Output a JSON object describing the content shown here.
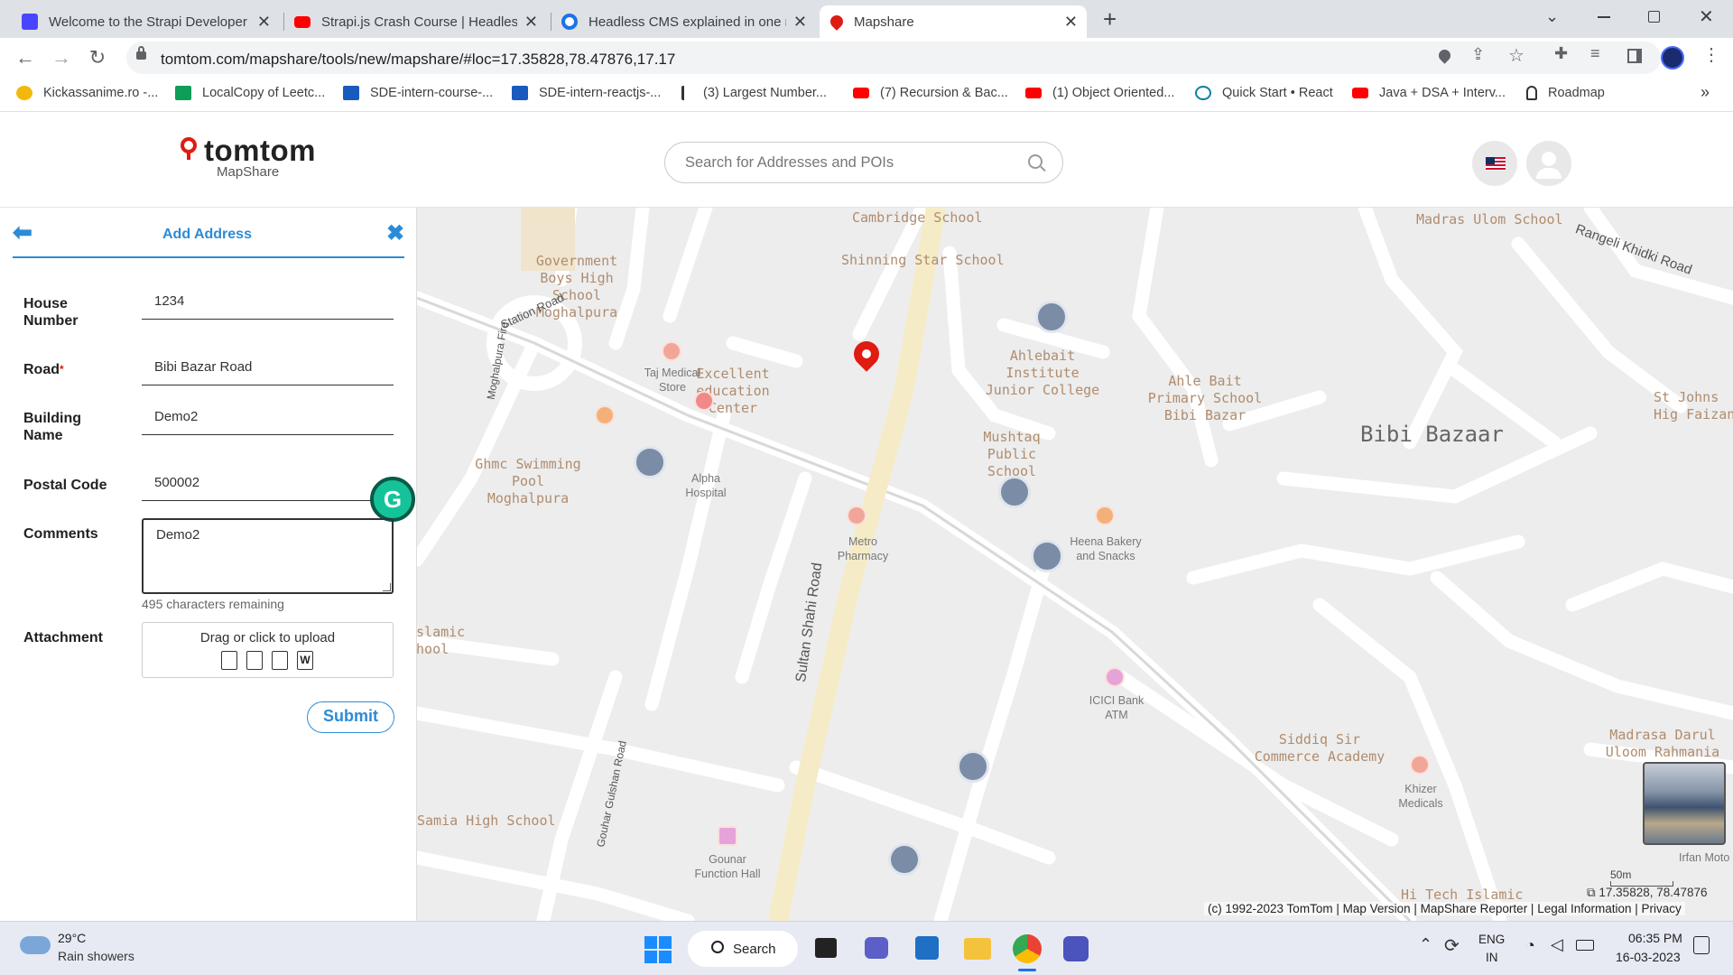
{
  "browser": {
    "tabs": [
      {
        "title": "Welcome to the Strapi Developer",
        "color": "#4945ff",
        "active": false
      },
      {
        "title": "Strapi.js Crash Course | Headless",
        "color": "#ff0000",
        "active": false
      },
      {
        "title": "Headless CMS explained in one m",
        "color": "#1a73e8",
        "active": false
      },
      {
        "title": "Mapshare",
        "color": "#df1b12",
        "active": true
      }
    ],
    "new_tab": "+",
    "url": "tomtom.com/mapshare/tools/new/mapshare/#loc=17.35828,78.47876,17.17",
    "bookmarks": [
      {
        "label": "Kickassanime.ro -...",
        "color": "#f2b90c"
      },
      {
        "label": "LocalCopy of Leetc...",
        "color": "#0f9d58"
      },
      {
        "label": "SDE-intern-course-...",
        "color": "#185abd"
      },
      {
        "label": "SDE-intern-reactjs-...",
        "color": "#185abd"
      },
      {
        "label": "(3) Largest Number...",
        "color": "#333333"
      },
      {
        "label": "(7) Recursion & Bac...",
        "color": "#ff0000"
      },
      {
        "label": "(1) Object Oriented...",
        "color": "#ff0000"
      },
      {
        "label": "Quick Start • React",
        "color": "#087ea4"
      },
      {
        "label": "Java + DSA + Interv...",
        "color": "#ff0000"
      },
      {
        "label": "Roadmap",
        "color": "#333333"
      }
    ],
    "more_bookmarks": "»"
  },
  "site": {
    "logo": "tomtom",
    "logo_sub": "MapShare",
    "search_placeholder": "Search for Addresses and POIs",
    "accent": "#df1b12"
  },
  "panel": {
    "title": "Add Address",
    "fields": {
      "house_label": "House Number",
      "house_value": "1234",
      "road_label": "Road",
      "road_required": "*",
      "road_value": "Bibi Bazar Road",
      "building_label": "Building Name",
      "building_value": "Demo2",
      "postal_label": "Postal Code",
      "postal_value": "500002",
      "comments_label": "Comments",
      "comments_value": "Demo2",
      "remaining": "495 characters remaining",
      "attachment_label": "Attachment",
      "upload_text": "Drag or click to upload"
    },
    "submit": "Submit",
    "accent": "#2c8bd6"
  },
  "map": {
    "labels": [
      "Cambridge School",
      "Madras Ulom School",
      "Rangeli Khidki Road",
      "Government Boys High School Moghalpura",
      "Shinning Star School",
      "Station Road",
      "Moghalpura Fire",
      "Excellent education Center",
      "Ahlebait Institute Junior College",
      "Ahle Bait Primary School Bibi Bazar",
      "St Johns Hig Faizan",
      "Bibi Bazaar",
      "Mushtaq Public School",
      "Ghmc Swimming Pool Moghalpura",
      "a Islamic chool",
      "Sultan Shahi Road",
      "Siddiq Sir Commerce Academy",
      "Madrasa Darul Uloom Rahmania",
      "Samia High School",
      "Gouhar Gulshan Road",
      "Hi Tech Islamic"
    ],
    "pois": [
      "Taj Medical Store",
      "Alpha Hospital",
      "Metro Pharmacy",
      "Heena Bakery and Snacks",
      "ICICI Bank ATM",
      "Khizer Medicals",
      "Gounar Function Hall",
      "Irfan Moto"
    ],
    "scale": "50m",
    "coords": "17.35828, 78.47876",
    "footer": "(c) 1992-2023 TomTom | Map Version | MapShare Reporter | Legal Information | Privacy"
  },
  "taskbar": {
    "weather_temp": "29°C",
    "weather_desc": "Rain showers",
    "search": "Search",
    "lang1": "ENG",
    "lang2": "IN",
    "time": "06:35 PM",
    "date": "16-03-2023"
  }
}
